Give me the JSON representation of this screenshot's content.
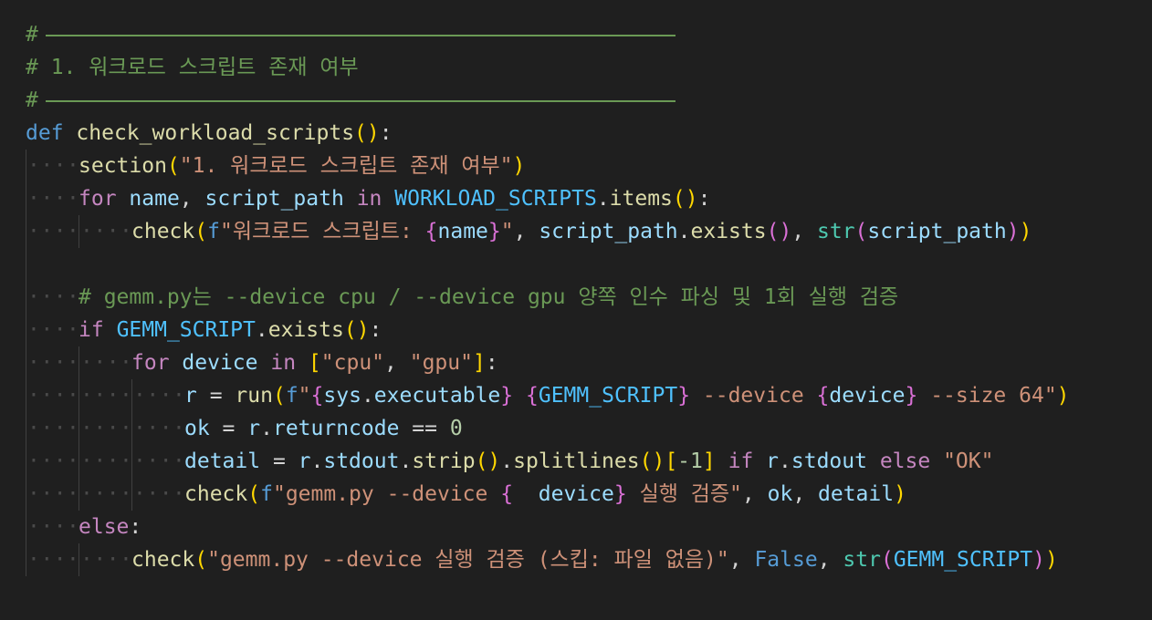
{
  "editor": {
    "lines": [
      {
        "id": "l1",
        "tokens": [
          {
            "t": "#",
            "c": "cm"
          },
          {
            "t": "rule",
            "c": "rule"
          }
        ]
      },
      {
        "id": "l2",
        "tokens": [
          {
            "t": "# 1. 워크로드 스크립트 존재 여부",
            "c": "cm"
          }
        ]
      },
      {
        "id": "l3",
        "tokens": [
          {
            "t": "#",
            "c": "cm"
          },
          {
            "t": "rule",
            "c": "rule"
          }
        ]
      },
      {
        "id": "l4",
        "tokens": [
          {
            "t": "def",
            "c": "kw"
          },
          {
            "t": " ",
            "c": "op"
          },
          {
            "t": "check_workload_scripts",
            "c": "fn"
          },
          {
            "t": "()",
            "c": "br1"
          },
          {
            "t": ":",
            "c": "op"
          }
        ]
      },
      {
        "id": "l5",
        "indent": 1,
        "tokens": [
          {
            "t": "section",
            "c": "fn"
          },
          {
            "t": "(",
            "c": "br1"
          },
          {
            "t": "\"1. 워크로드 스크립트 존재 여부\"",
            "c": "st"
          },
          {
            "t": ")",
            "c": "br1"
          }
        ]
      },
      {
        "id": "l6",
        "indent": 1,
        "tokens": [
          {
            "t": "for",
            "c": "ctl"
          },
          {
            "t": " ",
            "c": "op"
          },
          {
            "t": "name",
            "c": "var"
          },
          {
            "t": ", ",
            "c": "op"
          },
          {
            "t": "script_path",
            "c": "var"
          },
          {
            "t": " ",
            "c": "op"
          },
          {
            "t": "in",
            "c": "ctl"
          },
          {
            "t": " ",
            "c": "op"
          },
          {
            "t": "WORKLOAD_SCRIPTS",
            "c": "const"
          },
          {
            "t": ".",
            "c": "op"
          },
          {
            "t": "items",
            "c": "fn"
          },
          {
            "t": "()",
            "c": "br1"
          },
          {
            "t": ":",
            "c": "op"
          }
        ]
      },
      {
        "id": "l7",
        "indent": 2,
        "tokens": [
          {
            "t": "check",
            "c": "fn"
          },
          {
            "t": "(",
            "c": "br1"
          },
          {
            "t": "f",
            "c": "fstr"
          },
          {
            "t": "\"워크로드 스크립트: ",
            "c": "st"
          },
          {
            "t": "{",
            "c": "br2"
          },
          {
            "t": "name",
            "c": "var"
          },
          {
            "t": "}",
            "c": "br2"
          },
          {
            "t": "\"",
            "c": "st"
          },
          {
            "t": ", ",
            "c": "op"
          },
          {
            "t": "script_path",
            "c": "var"
          },
          {
            "t": ".",
            "c": "op"
          },
          {
            "t": "exists",
            "c": "fn"
          },
          {
            "t": "()",
            "c": "br2"
          },
          {
            "t": ", ",
            "c": "op"
          },
          {
            "t": "str",
            "c": "bi"
          },
          {
            "t": "(",
            "c": "br2"
          },
          {
            "t": "script_path",
            "c": "var"
          },
          {
            "t": ")",
            "c": "br2"
          },
          {
            "t": ")",
            "c": "br1"
          }
        ]
      },
      {
        "id": "l8",
        "indent": 0,
        "blank": true,
        "tokens": []
      },
      {
        "id": "l9",
        "indent": 1,
        "tokens": [
          {
            "t": "# gemm.py는 --device cpu / --device gpu 양쪽 인수 파싱 및 1회 실행 검증",
            "c": "cm"
          }
        ]
      },
      {
        "id": "l10",
        "indent": 1,
        "tokens": [
          {
            "t": "if",
            "c": "ctl"
          },
          {
            "t": " ",
            "c": "op"
          },
          {
            "t": "GEMM_SCRIPT",
            "c": "const"
          },
          {
            "t": ".",
            "c": "op"
          },
          {
            "t": "exists",
            "c": "fn"
          },
          {
            "t": "()",
            "c": "br1"
          },
          {
            "t": ":",
            "c": "op"
          }
        ]
      },
      {
        "id": "l11",
        "indent": 2,
        "tokens": [
          {
            "t": "for",
            "c": "ctl"
          },
          {
            "t": " ",
            "c": "op"
          },
          {
            "t": "device",
            "c": "var"
          },
          {
            "t": " ",
            "c": "op"
          },
          {
            "t": "in",
            "c": "ctl"
          },
          {
            "t": " ",
            "c": "op"
          },
          {
            "t": "[",
            "c": "br1"
          },
          {
            "t": "\"cpu\"",
            "c": "st"
          },
          {
            "t": ", ",
            "c": "op"
          },
          {
            "t": "\"gpu\"",
            "c": "st"
          },
          {
            "t": "]",
            "c": "br1"
          },
          {
            "t": ":",
            "c": "op"
          }
        ]
      },
      {
        "id": "l12",
        "indent": 3,
        "tokens": [
          {
            "t": "r",
            "c": "var"
          },
          {
            "t": " = ",
            "c": "op"
          },
          {
            "t": "run",
            "c": "fn"
          },
          {
            "t": "(",
            "c": "br1"
          },
          {
            "t": "f",
            "c": "fstr"
          },
          {
            "t": "\"",
            "c": "st"
          },
          {
            "t": "{",
            "c": "br2"
          },
          {
            "t": "sys",
            "c": "var"
          },
          {
            "t": ".",
            "c": "op"
          },
          {
            "t": "executable",
            "c": "var"
          },
          {
            "t": "}",
            "c": "br2"
          },
          {
            "t": " ",
            "c": "st"
          },
          {
            "t": "{",
            "c": "br2"
          },
          {
            "t": "GEMM_SCRIPT",
            "c": "const"
          },
          {
            "t": "}",
            "c": "br2"
          },
          {
            "t": " --device ",
            "c": "st"
          },
          {
            "t": "{",
            "c": "br2"
          },
          {
            "t": "device",
            "c": "var"
          },
          {
            "t": "}",
            "c": "br2"
          },
          {
            "t": " --size 64\"",
            "c": "st"
          },
          {
            "t": ")",
            "c": "br1"
          }
        ]
      },
      {
        "id": "l13",
        "indent": 3,
        "tokens": [
          {
            "t": "ok",
            "c": "var"
          },
          {
            "t": " = ",
            "c": "op"
          },
          {
            "t": "r",
            "c": "var"
          },
          {
            "t": ".",
            "c": "op"
          },
          {
            "t": "returncode",
            "c": "var"
          },
          {
            "t": " == ",
            "c": "op"
          },
          {
            "t": "0",
            "c": "num"
          }
        ]
      },
      {
        "id": "l14",
        "indent": 3,
        "tokens": [
          {
            "t": "detail",
            "c": "var"
          },
          {
            "t": " = ",
            "c": "op"
          },
          {
            "t": "r",
            "c": "var"
          },
          {
            "t": ".",
            "c": "op"
          },
          {
            "t": "stdout",
            "c": "var"
          },
          {
            "t": ".",
            "c": "op"
          },
          {
            "t": "strip",
            "c": "fn"
          },
          {
            "t": "()",
            "c": "br1"
          },
          {
            "t": ".",
            "c": "op"
          },
          {
            "t": "splitlines",
            "c": "fn"
          },
          {
            "t": "()",
            "c": "br1"
          },
          {
            "t": "[",
            "c": "br1"
          },
          {
            "t": "-1",
            "c": "num"
          },
          {
            "t": "]",
            "c": "br1"
          },
          {
            "t": " ",
            "c": "op"
          },
          {
            "t": "if",
            "c": "ctl"
          },
          {
            "t": " ",
            "c": "op"
          },
          {
            "t": "r",
            "c": "var"
          },
          {
            "t": ".",
            "c": "op"
          },
          {
            "t": "stdout",
            "c": "var"
          },
          {
            "t": " ",
            "c": "op"
          },
          {
            "t": "else",
            "c": "ctl"
          },
          {
            "t": " ",
            "c": "op"
          },
          {
            "t": "\"OK\"",
            "c": "st"
          }
        ]
      },
      {
        "id": "l15",
        "indent": 3,
        "tokens": [
          {
            "t": "check",
            "c": "fn"
          },
          {
            "t": "(",
            "c": "br1"
          },
          {
            "t": "f",
            "c": "fstr"
          },
          {
            "t": "\"gemm.py --device ",
            "c": "st"
          },
          {
            "t": "{",
            "c": "br2"
          },
          {
            "t": "  device",
            "c": "var"
          },
          {
            "t": "}",
            "c": "br2"
          },
          {
            "t": " 실행 검증\"",
            "c": "st"
          },
          {
            "t": ", ",
            "c": "op"
          },
          {
            "t": "ok",
            "c": "var"
          },
          {
            "t": ", ",
            "c": "op"
          },
          {
            "t": "detail",
            "c": "var"
          },
          {
            "t": ")",
            "c": "br1"
          }
        ]
      },
      {
        "id": "l16",
        "indent": 1,
        "tokens": [
          {
            "t": "else",
            "c": "ctl"
          },
          {
            "t": ":",
            "c": "op"
          }
        ]
      },
      {
        "id": "l17",
        "indent": 2,
        "tokens": [
          {
            "t": "check",
            "c": "fn"
          },
          {
            "t": "(",
            "c": "br1"
          },
          {
            "t": "\"gemm.py --device 실행 검증 (스킵: 파일 없음)\"",
            "c": "st"
          },
          {
            "t": ", ",
            "c": "op"
          },
          {
            "t": "False",
            "c": "kw"
          },
          {
            "t": ", ",
            "c": "op"
          },
          {
            "t": "str",
            "c": "bi"
          },
          {
            "t": "(",
            "c": "br2"
          },
          {
            "t": "GEMM_SCRIPT",
            "c": "const"
          },
          {
            "t": ")",
            "c": "br2"
          },
          {
            "t": ")",
            "c": "br1"
          }
        ]
      }
    ]
  }
}
